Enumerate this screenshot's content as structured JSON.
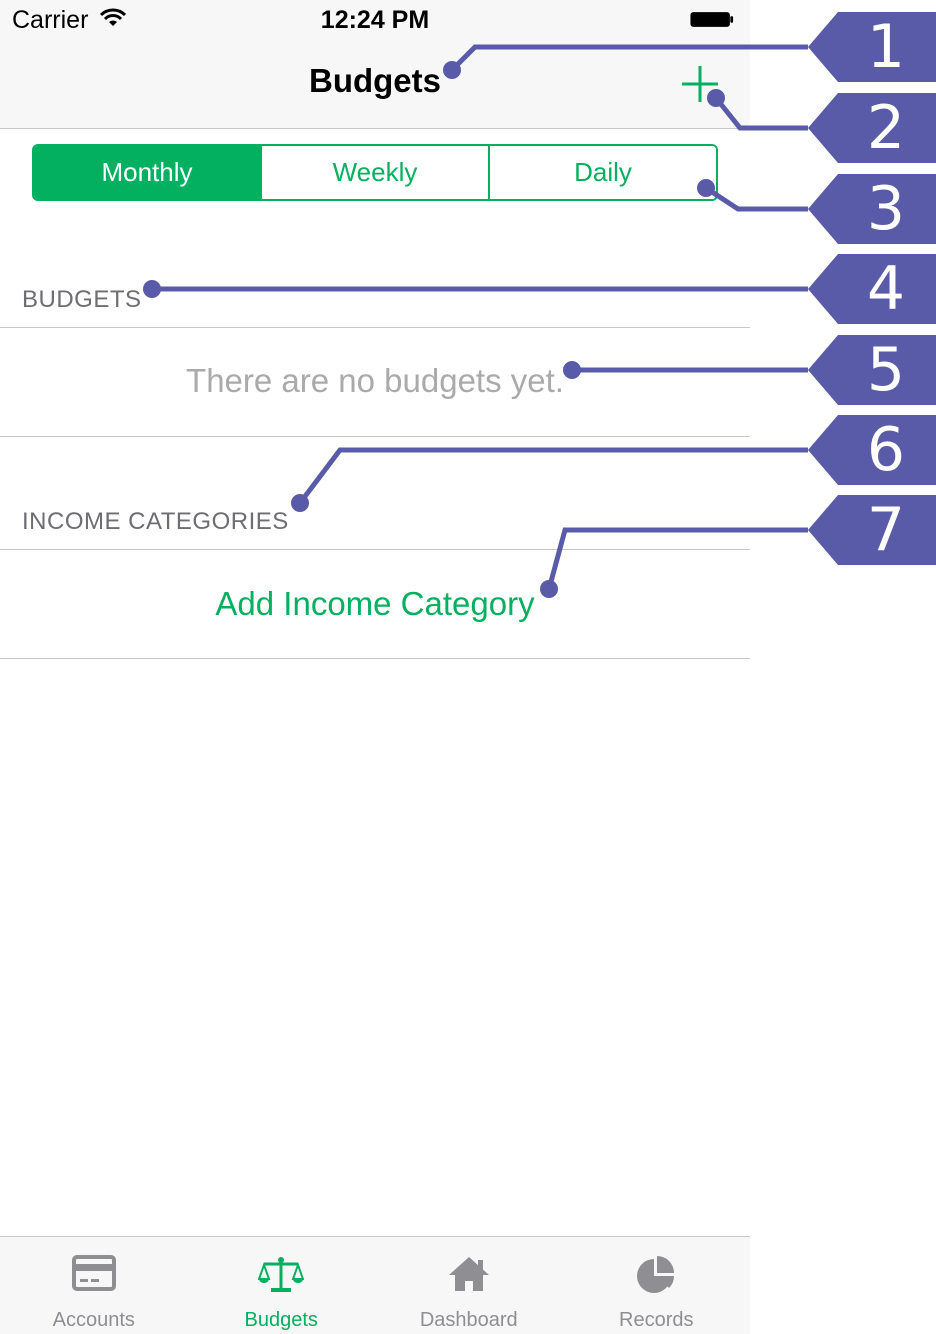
{
  "status_bar": {
    "carrier": "Carrier",
    "time": "12:24 PM"
  },
  "nav": {
    "title": "Budgets",
    "add_icon": "plus-icon"
  },
  "segments": [
    {
      "label": "Monthly",
      "selected": true
    },
    {
      "label": "Weekly",
      "selected": false
    },
    {
      "label": "Daily",
      "selected": false
    }
  ],
  "budgets_section": {
    "header": "BUDGETS",
    "empty_message": "There are no budgets yet."
  },
  "income_section": {
    "header": "INCOME CATEGORIES",
    "add_label": "Add Income Category"
  },
  "tabs": [
    {
      "label": "Accounts",
      "icon": "credit-card-icon",
      "active": false
    },
    {
      "label": "Budgets",
      "icon": "scales-icon",
      "active": true
    },
    {
      "label": "Dashboard",
      "icon": "home-icon",
      "active": false
    },
    {
      "label": "Records",
      "icon": "pie-chart-icon",
      "active": false
    }
  ],
  "callouts": [
    "1",
    "2",
    "3",
    "4",
    "5",
    "6",
    "7"
  ],
  "colors": {
    "accent": "#03b060",
    "callout": "#5a5ba8",
    "secondary_text": "#6d6d72",
    "placeholder_text": "#aaaaaa",
    "tab_inactive": "#8e8e93"
  }
}
